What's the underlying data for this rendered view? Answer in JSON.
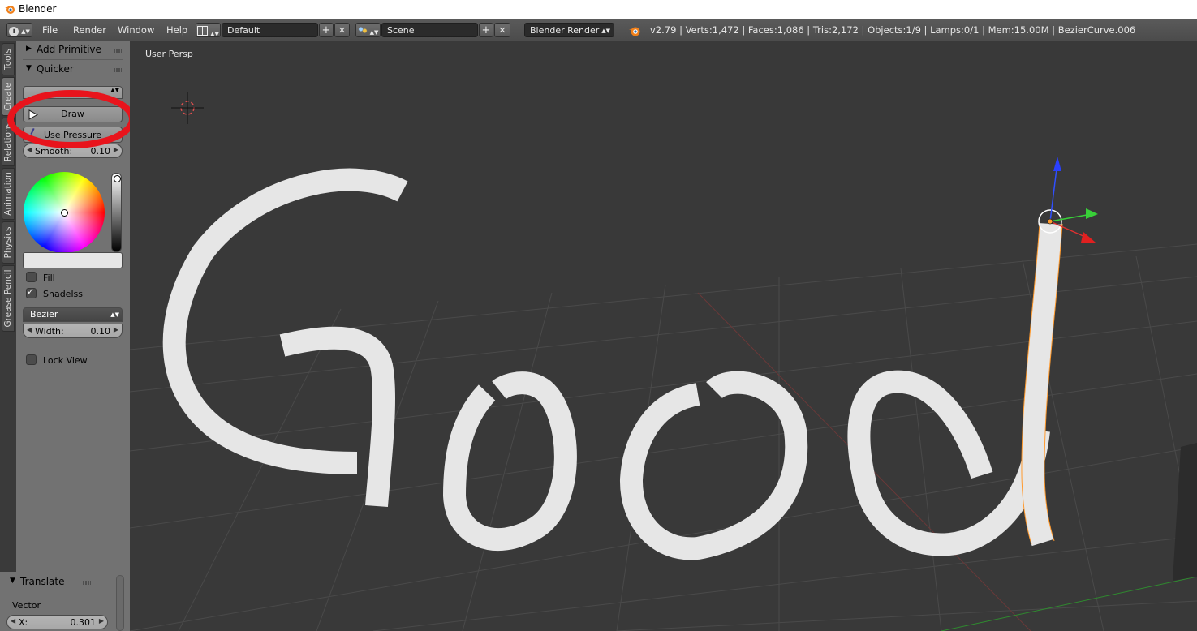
{
  "window": {
    "title": "Blender"
  },
  "menu": [
    "File",
    "Render",
    "Window",
    "Help"
  ],
  "header": {
    "layout": "Default",
    "scene": "Scene",
    "engine": "Blender Render",
    "stats": "v2.79 | Verts:1,472 | Faces:1,086 | Tris:2,172 | Objects:1/9 | Lamps:0/1 | Mem:15.00M | BezierCurve.006"
  },
  "tabs": [
    "Tools",
    "Create",
    "Relations",
    "Animation",
    "Physics",
    "Grease Pencil"
  ],
  "panels": {
    "add_primitive": "Add Primitive",
    "quicker": "Quicker",
    "draw": "Draw",
    "use_pressure": "Use Pressure",
    "smooth": {
      "label": "Smooth:",
      "value": "0.10"
    },
    "fill": "Fill",
    "shadeless": "Shadelss",
    "curve_type": "Bezier",
    "width": {
      "label": "Width:",
      "value": "0.10"
    },
    "lock_view": "Lock View",
    "translate": "Translate",
    "vector": "Vector",
    "x": {
      "label": "X:",
      "value": "0.301"
    }
  },
  "checks": {
    "fill": false,
    "shadeless": true,
    "lock_view": false
  },
  "viewport": {
    "label": "User Persp",
    "text_drawn": "Good"
  },
  "colors": {
    "annotation": "#e8141c",
    "stroke": "#e6e6e6",
    "selected": "#ff9a2e"
  },
  "icons": [
    "blender-logo-icon",
    "info-icon",
    "editor-layout-icon",
    "scene-icon",
    "render-engine-icon",
    "draw-play-icon",
    "pressure-pen-icon",
    "3d-cursor-icon",
    "transform-gizmo-icon"
  ]
}
